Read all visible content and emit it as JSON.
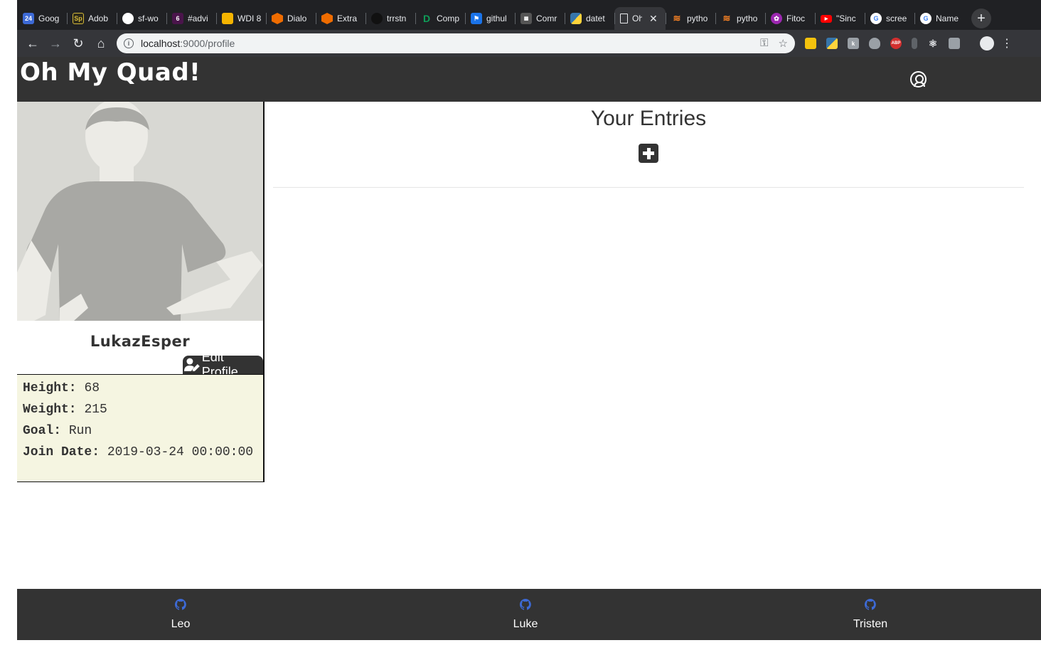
{
  "browser": {
    "tabs": [
      {
        "label": "Goog",
        "fav": "24",
        "color": "#3d6ad6"
      },
      {
        "label": "Adob",
        "fav": "Sp",
        "color": "#2d2a1a"
      },
      {
        "label": "sf-wo",
        "fav": "",
        "color": "#202124"
      },
      {
        "label": "#advi",
        "fav": "6",
        "color": "#4a154b"
      },
      {
        "label": "WDI 8",
        "fav": "",
        "color": "#f4b400"
      },
      {
        "label": "Dialo",
        "fav": "",
        "color": "#ef6c00"
      },
      {
        "label": "Extra",
        "fav": "",
        "color": "#ef6c00"
      },
      {
        "label": "trrstn",
        "fav": "",
        "color": "#202124"
      },
      {
        "label": "Comp",
        "fav": "D",
        "color": "#0f9d58"
      },
      {
        "label": "githul",
        "fav": "",
        "color": "#1a73e8"
      },
      {
        "label": "Comr",
        "fav": "",
        "color": "#555555"
      },
      {
        "label": "datet",
        "fav": "",
        "color": "#3776ab"
      },
      {
        "label": "Oh My Quad!",
        "fav": "",
        "color": "#35363a",
        "active": true
      },
      {
        "label": "pytho",
        "fav": "",
        "color": "#f48024"
      },
      {
        "label": "pytho",
        "fav": "",
        "color": "#f48024"
      },
      {
        "label": "Fitoc",
        "fav": "",
        "color": "#9c27b0"
      },
      {
        "label": "\"Sinc",
        "fav": "",
        "color": "#ff0000"
      },
      {
        "label": "scree",
        "fav": "G",
        "color": "#ffffff"
      },
      {
        "label": "Name",
        "fav": "G",
        "color": "#ffffff"
      }
    ],
    "url_host": "localhost",
    "url_path": ":9000/profile"
  },
  "app": {
    "brand": "Oh My Quad!"
  },
  "profile": {
    "username": "LukazEsper",
    "edit_label": "Edit Profile",
    "stats": [
      {
        "label": "Height:",
        "value": "68"
      },
      {
        "label": "Weight:",
        "value": "215"
      },
      {
        "label": "Goal:",
        "value": "Run"
      },
      {
        "label": "Join Date:",
        "value": "2019-03-24 00:00:00"
      }
    ]
  },
  "entries": {
    "title": "Your Entries"
  },
  "footer": {
    "credits": [
      {
        "name": "Leo"
      },
      {
        "name": "Luke"
      },
      {
        "name": "Tristen"
      }
    ],
    "icon_color": "#3d6ad6"
  }
}
